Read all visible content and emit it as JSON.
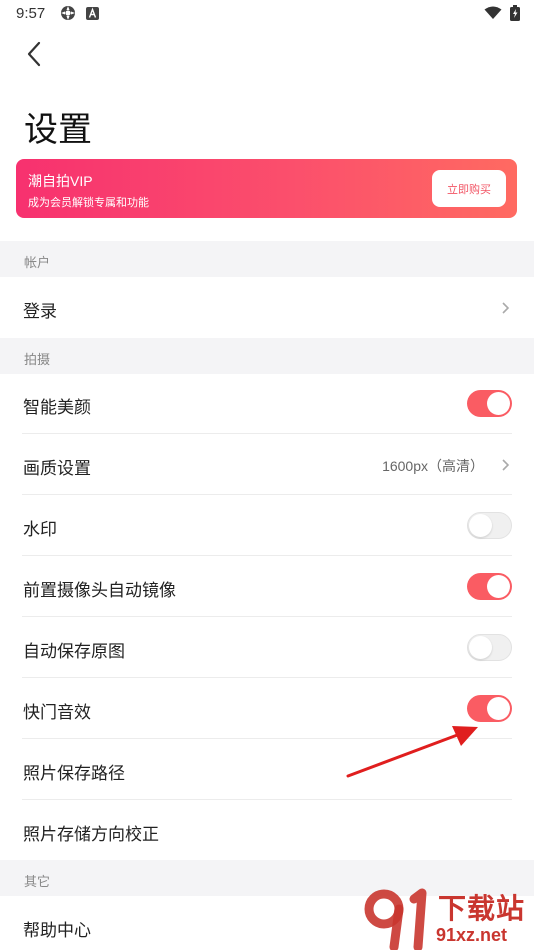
{
  "status_bar": {
    "time": "9:57",
    "left_icons": [
      "settings-app-icon",
      "a-icon"
    ],
    "right_icons": [
      "wifi-icon",
      "battery-charging-icon"
    ]
  },
  "header": {
    "back_icon": "chevron-left-icon",
    "title": "设置"
  },
  "vip_banner": {
    "title": "潮自拍VIP",
    "subtitle": "成为会员解锁专属和功能",
    "button_label": "立即购买",
    "gradient_start": "#f7316f",
    "gradient_end": "#ff6a61"
  },
  "sections": {
    "account": {
      "header": "帐户",
      "login_label": "登录"
    },
    "shooting": {
      "header": "拍摄",
      "smart_beauty": {
        "label": "智能美颜",
        "enabled": true
      },
      "quality": {
        "label": "画质设置",
        "value": "1600px（高清）"
      },
      "watermark": {
        "label": "水印",
        "enabled": false
      },
      "front_mirror": {
        "label": "前置摄像头自动镜像",
        "enabled": true
      },
      "auto_save_original": {
        "label": "自动保存原图",
        "enabled": false
      },
      "shutter_sound": {
        "label": "快门音效",
        "enabled": true
      },
      "photo_save_path": {
        "label": "照片保存路径"
      },
      "photo_orientation": {
        "label": "照片存储方向校正"
      }
    },
    "other": {
      "header": "其它",
      "help_center": {
        "label": "帮助中心"
      }
    }
  },
  "annotation": {
    "arrow_color": "#e01e1e"
  },
  "watermark": {
    "logo_text": "下载站",
    "site_text": "91xz.net",
    "color": "#c9362f"
  },
  "colors": {
    "toggle_on": "#fa5c63",
    "toggle_off": "#f0f0f0",
    "section_bg": "#f4f4f6"
  }
}
